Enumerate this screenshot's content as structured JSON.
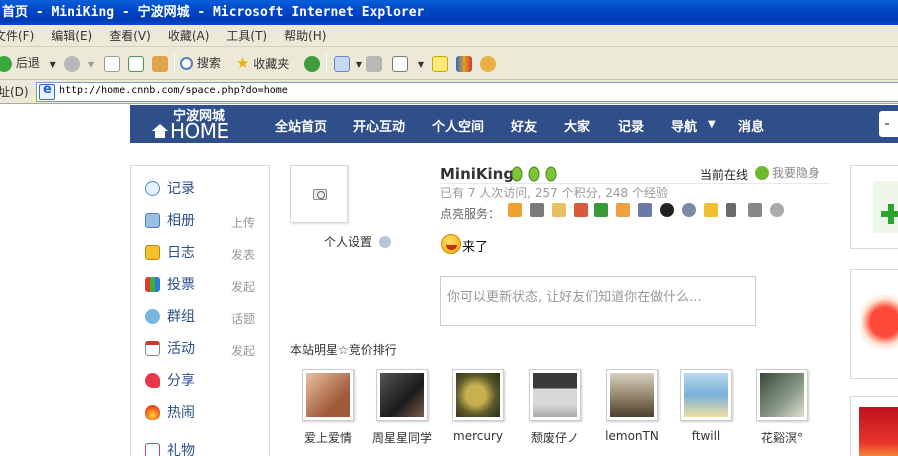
{
  "window": {
    "title": "首页 - MiniKing - 宁波网城 - Microsoft Internet Explorer"
  },
  "menubar": [
    "文件(F)",
    "编辑(E)",
    "查看(V)",
    "收藏(A)",
    "工具(T)",
    "帮助(H)"
  ],
  "toolbar": {
    "back_label": "后退",
    "search_label": "搜索",
    "favorites_label": "收藏夹"
  },
  "addressbar": {
    "label": "址(D)",
    "url": "http://home.cnnb.com/space.php?do=home"
  },
  "site": {
    "logo_cn": "宁波网城",
    "logo_en": "HOME",
    "nav": [
      "全站首页",
      "开心互动",
      "个人空间",
      "好友",
      "大家",
      "记录",
      "导航",
      "消息"
    ]
  },
  "sidebar": {
    "items": [
      {
        "label": "记录",
        "action": ""
      },
      {
        "label": "相册",
        "action": "上传"
      },
      {
        "label": "日志",
        "action": "发表"
      },
      {
        "label": "投票",
        "action": "发起"
      },
      {
        "label": "群组",
        "action": "话题"
      },
      {
        "label": "活动",
        "action": "发起"
      },
      {
        "label": "分享",
        "action": ""
      },
      {
        "label": "热闹",
        "action": ""
      },
      {
        "label": "礼物",
        "action": ""
      }
    ]
  },
  "profile": {
    "settings_label": "个人设置",
    "username": "MiniKing",
    "online_status": "当前在线",
    "hide_label": "我要隐身",
    "stats": "已有 7 人次访问, 257 个积分, 248 个经验",
    "services_label": "点亮服务：",
    "mood": "来了",
    "status_placeholder": "你可以更新状态, 让好友们知道你在做什么..."
  },
  "stars": {
    "title": "本站明星☆竞价排行",
    "items": [
      {
        "name": "爱上爱情",
        "color": "#c48a6a"
      },
      {
        "name": "周星星同学",
        "color": "#3a3a3a"
      },
      {
        "name": "mercury",
        "color": "#6d6a3a"
      },
      {
        "name": "颓废仔ノ",
        "color": "#8e8e8e"
      },
      {
        "name": "lemonTN",
        "color": "#7a7060"
      },
      {
        "name": "ftwill",
        "color": "#7fb2dc"
      },
      {
        "name": "花谿溟°",
        "color": "#5a6a5a"
      }
    ]
  },
  "colors": {
    "nav_bg": "#2f4f8a",
    "link": "#2b4e8c",
    "titlebar": "#0046c8"
  }
}
